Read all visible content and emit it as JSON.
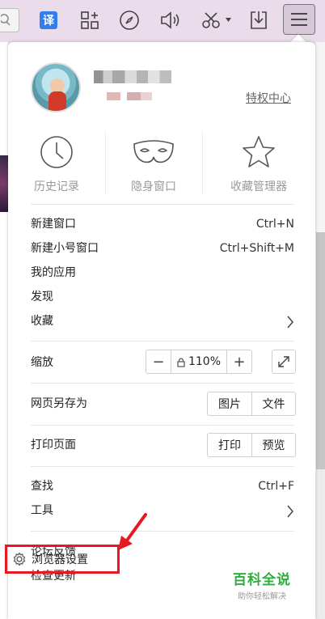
{
  "toolbar": {
    "icons": [
      "search-icon",
      "translate-icon",
      "apps-icon",
      "compass-icon",
      "volume-icon",
      "scissors-icon",
      "download-icon",
      "menu-icon"
    ],
    "translate_label": "译"
  },
  "panel": {
    "privilege_link": "特权中心",
    "quick_actions": [
      {
        "label": "历史记录",
        "icon": "clock-icon"
      },
      {
        "label": "隐身窗口",
        "icon": "mask-icon"
      },
      {
        "label": "收藏管理器",
        "icon": "star-icon"
      }
    ],
    "menu": {
      "new_window": {
        "label": "新建窗口",
        "shortcut": "Ctrl+N"
      },
      "new_small_window": {
        "label": "新建小号窗口",
        "shortcut": "Ctrl+Shift+M"
      },
      "my_apps": {
        "label": "我的应用"
      },
      "discover": {
        "label": "发现"
      },
      "favorites": {
        "label": "收藏"
      },
      "zoom": {
        "label": "缩放",
        "minus": "−",
        "value": "110%",
        "plus": "+"
      },
      "save_as": {
        "label": "网页另存为",
        "options": [
          "图片",
          "文件"
        ]
      },
      "print": {
        "label": "打印页面",
        "options": [
          "打印",
          "预览"
        ]
      },
      "find": {
        "label": "查找",
        "shortcut": "Ctrl+F"
      },
      "tools": {
        "label": "工具"
      },
      "feedback": {
        "label": "论坛反馈"
      },
      "check_update": {
        "label": "检查更新"
      },
      "settings": {
        "label": "浏览器设置"
      }
    }
  },
  "watermark": {
    "title": "百科全说",
    "subtitle": "助你轻松解决"
  },
  "colors": {
    "accent_green": "#2cae3d",
    "highlight_red": "#e5191f",
    "translate_blue": "#2f7ff0"
  }
}
